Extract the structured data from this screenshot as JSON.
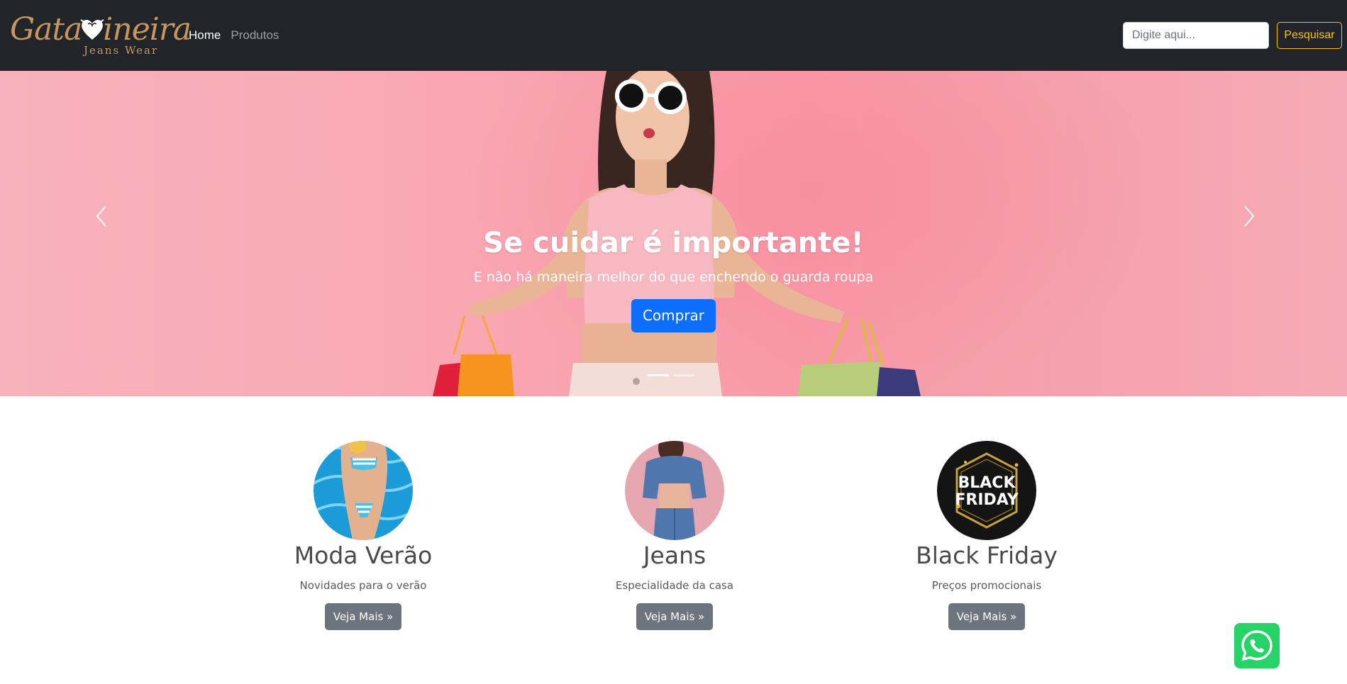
{
  "brand": {
    "name": "GataMineira",
    "script_text": "Gata",
    "script_text_2": "ineira",
    "subtitle": "Jeans Wear"
  },
  "nav": {
    "items": [
      {
        "label": "Home",
        "active": true
      },
      {
        "label": "Produtos",
        "active": false
      }
    ]
  },
  "search": {
    "placeholder": "Digite aqui...",
    "value": "",
    "button_label": "Pesquisar"
  },
  "colors": {
    "navbar_bg": "#212529",
    "accent_yellow": "#ffc107",
    "primary_blue": "#0d6efd",
    "secondary_gray": "#6c757d",
    "whatsapp_green": "#25d366",
    "hero_pink": "#f9a9b4"
  },
  "carousel": {
    "title": "Se cuidar é importante!",
    "text": "E não há maneira melhor do que enchendo o guarda roupa",
    "button_label": "Comprar",
    "prev_icon": "chevron-left-icon",
    "next_icon": "chevron-right-icon",
    "indicators": [
      {
        "active": true
      },
      {
        "active": false
      }
    ]
  },
  "categories": [
    {
      "title": "Moda Verão",
      "description": "Novidades para o verão",
      "button_label": "Veja Mais »",
      "image": "swimwear"
    },
    {
      "title": "Jeans",
      "description": "Especialidade da casa",
      "button_label": "Veja Mais »",
      "image": "denim"
    },
    {
      "title": "Black Friday",
      "description": "Preços promocionais",
      "button_label": "Veja Mais »",
      "image": "black-friday-badge",
      "badge_line_1": "BLACK",
      "badge_line_2": "FRIDAY"
    }
  ],
  "floating": {
    "icon": "whatsapp-icon"
  }
}
